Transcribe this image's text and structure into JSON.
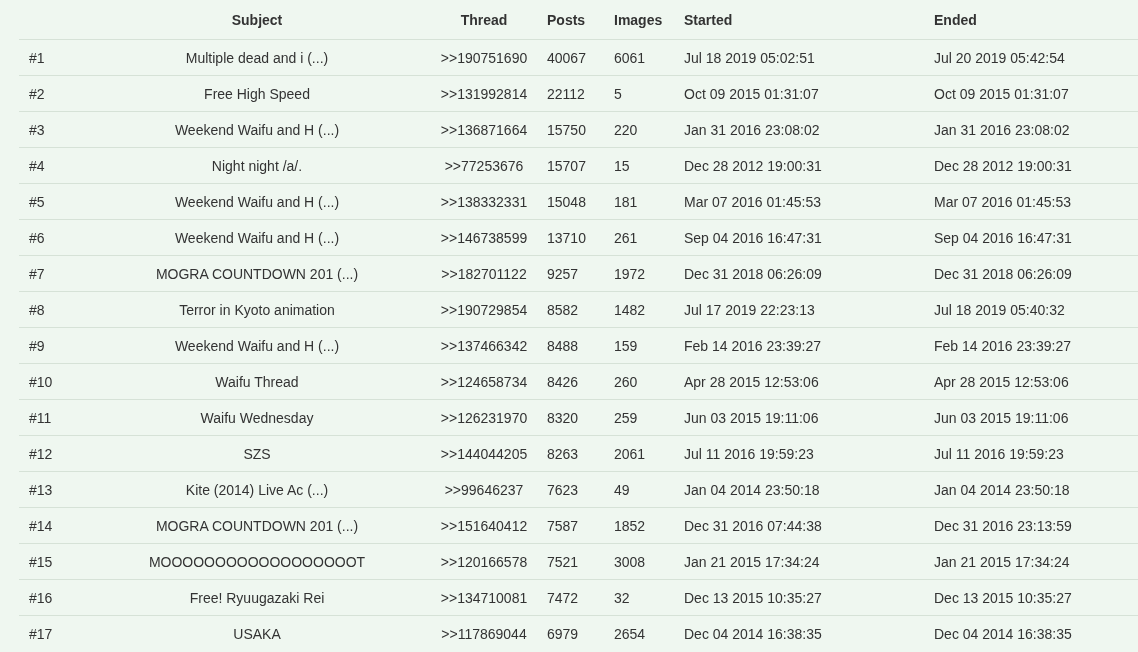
{
  "table": {
    "columns": [
      "",
      "Subject",
      "Thread",
      "Posts",
      "Images",
      "Started",
      "Ended"
    ],
    "rows": [
      [
        "#1",
        "Multiple dead and i (...)",
        ">>190751690",
        "40067",
        "6061",
        "Jul 18 2019 05:02:51",
        "Jul 20 2019 05:42:54"
      ],
      [
        "#2",
        "Free High Speed",
        ">>131992814",
        "22112",
        "5",
        "Oct 09 2015 01:31:07",
        "Oct 09 2015 01:31:07"
      ],
      [
        "#3",
        "Weekend Waifu and H (...)",
        ">>136871664",
        "15750",
        "220",
        "Jan 31 2016 23:08:02",
        "Jan 31 2016 23:08:02"
      ],
      [
        "#4",
        "Night night /a/.",
        ">>77253676",
        "15707",
        "15",
        "Dec 28 2012 19:00:31",
        "Dec 28 2012 19:00:31"
      ],
      [
        "#5",
        "Weekend Waifu and H (...)",
        ">>138332331",
        "15048",
        "181",
        "Mar 07 2016 01:45:53",
        "Mar 07 2016 01:45:53"
      ],
      [
        "#6",
        "Weekend Waifu and H (...)",
        ">>146738599",
        "13710",
        "261",
        "Sep 04 2016 16:47:31",
        "Sep 04 2016 16:47:31"
      ],
      [
        "#7",
        "MOGRA COUNTDOWN 201 (...)",
        ">>182701122",
        "9257",
        "1972",
        "Dec 31 2018 06:26:09",
        "Dec 31 2018 06:26:09"
      ],
      [
        "#8",
        "Terror in Kyoto animation",
        ">>190729854",
        "8582",
        "1482",
        "Jul 17 2019 22:23:13",
        "Jul 18 2019 05:40:32"
      ],
      [
        "#9",
        "Weekend Waifu and H (...)",
        ">>137466342",
        "8488",
        "159",
        "Feb 14 2016 23:39:27",
        "Feb 14 2016 23:39:27"
      ],
      [
        "#10",
        "Waifu Thread",
        ">>124658734",
        "8426",
        "260",
        "Apr 28 2015 12:53:06",
        "Apr 28 2015 12:53:06"
      ],
      [
        "#11",
        "Waifu Wednesday",
        ">>126231970",
        "8320",
        "259",
        "Jun 03 2015 19:11:06",
        "Jun 03 2015 19:11:06"
      ],
      [
        "#12",
        "SZS",
        ">>144044205",
        "8263",
        "2061",
        "Jul 11 2016 19:59:23",
        "Jul 11 2016 19:59:23"
      ],
      [
        "#13",
        "Kite (2014) Live Ac (...)",
        ">>99646237",
        "7623",
        "49",
        "Jan 04 2014 23:50:18",
        "Jan 04 2014 23:50:18"
      ],
      [
        "#14",
        "MOGRA COUNTDOWN 201 (...)",
        ">>151640412",
        "7587",
        "1852",
        "Dec 31 2016 07:44:38",
        "Dec 31 2016 23:13:59"
      ],
      [
        "#15",
        "MOOOOOOOOOOOOOOOOOOT",
        ">>120166578",
        "7521",
        "3008",
        "Jan 21 2015 17:34:24",
        "Jan 21 2015 17:34:24"
      ],
      [
        "#16",
        "Free! Ryuugazaki Rei",
        ">>134710081",
        "7472",
        "32",
        "Dec 13 2015 10:35:27",
        "Dec 13 2015 10:35:27"
      ],
      [
        "#17",
        "USAKA",
        ">>117869044",
        "6979",
        "2654",
        "Dec 04 2014 16:38:35",
        "Dec 04 2014 16:38:35"
      ]
    ]
  }
}
